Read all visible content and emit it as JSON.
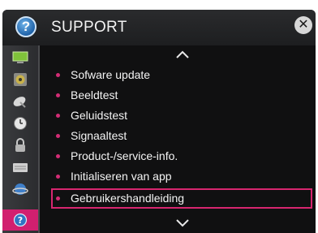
{
  "header": {
    "title": "SUPPORT",
    "help_icon": "question-circle-icon",
    "close_icon": "close-icon"
  },
  "sidebar": {
    "items": [
      {
        "name": "picture-icon",
        "glyph": "▬"
      },
      {
        "name": "speaker-icon",
        "glyph": "◉"
      },
      {
        "name": "satellite-icon",
        "glyph": "◣"
      },
      {
        "name": "clock-icon",
        "glyph": "◷"
      },
      {
        "name": "lock-icon",
        "glyph": "🔒"
      },
      {
        "name": "keyboard-icon",
        "glyph": "▤"
      },
      {
        "name": "network-globe-icon",
        "glyph": "◍"
      },
      {
        "name": "support-help-icon",
        "glyph": "?",
        "active": true
      }
    ]
  },
  "menu": {
    "scroll_up": "chevron-up-icon",
    "scroll_down": "chevron-down-icon",
    "items": [
      {
        "label": "Sofware update"
      },
      {
        "label": "Beeldtest"
      },
      {
        "label": "Geluidstest"
      },
      {
        "label": "Signaaltest"
      },
      {
        "label": "Product-/service-info."
      },
      {
        "label": "Initialiseren van app"
      },
      {
        "label": "Gebruikershandleiding",
        "selected": true
      }
    ]
  },
  "colors": {
    "accent": "#d11f6f",
    "background": "#101011",
    "header": "#242527",
    "text": "#f4f4f4"
  }
}
